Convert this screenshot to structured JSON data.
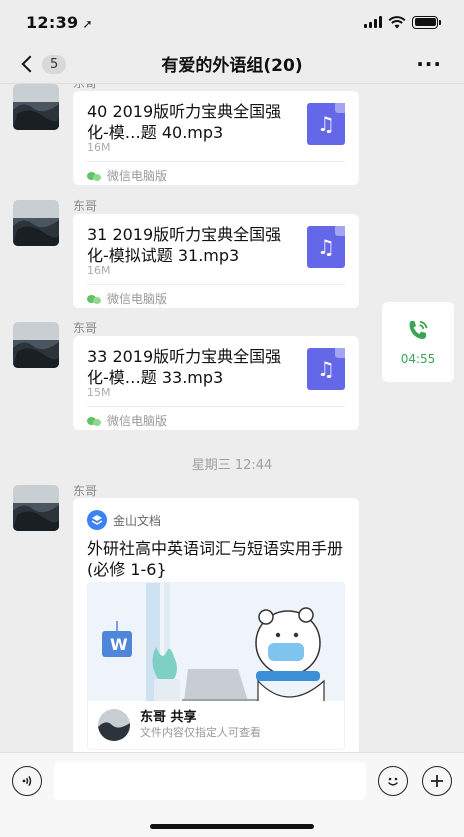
{
  "status_bar": {
    "time": "12:39",
    "location_arrow": "location-arrow-icon"
  },
  "nav": {
    "back_badge": "5",
    "title": "有爱的外语组(20)",
    "more": "···"
  },
  "messages": [
    {
      "sender": "东哥",
      "file_title": "40 2019版听力宝典全国强化-模…题 40.mp3",
      "size": "16M",
      "source": "微信电脑版",
      "icon": "music-file-icon"
    },
    {
      "sender": "东哥",
      "file_title": "31 2019版听力宝典全国强化-模拟试题 31.mp3",
      "size": "16M",
      "source": "微信电脑版",
      "icon": "music-file-icon"
    },
    {
      "sender": "东哥",
      "file_title": "33 2019版听力宝典全国强化-模…题 33.mp3",
      "size": "15M",
      "source": "微信电脑版",
      "icon": "music-file-icon"
    }
  ],
  "call": {
    "duration": "04:55",
    "icon": "phone-call-icon",
    "color": "#3aa655"
  },
  "timestamp": "星期三 12:44",
  "doc_message": {
    "sender": "东哥",
    "app_name": "金山文档",
    "title": "外研社高中英语词汇与短语实用手册 (必修 1-6}",
    "share_text": "东哥 共享",
    "note": "文件内容仅指定人可查看"
  },
  "input": {
    "placeholder": ""
  },
  "colors": {
    "file_icon": "#6467e8",
    "background": "#ededed",
    "wechat_green": "#5fc463"
  }
}
